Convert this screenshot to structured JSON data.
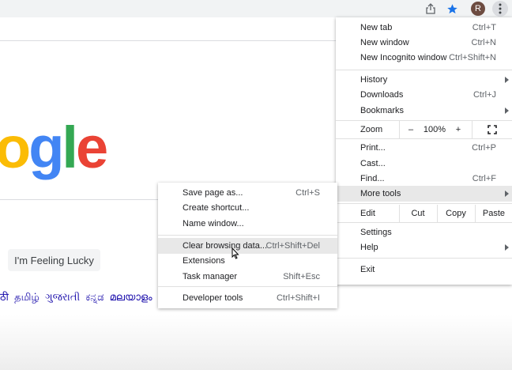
{
  "toolbar": {
    "avatar_initial": "R",
    "icons": {
      "share": "share-icon",
      "star": "star-icon",
      "menu": "kebab-menu-icon"
    },
    "colors": {
      "star": "#1a73e8",
      "avatar_bg": "#6d4c41"
    }
  },
  "page": {
    "logo_text": "ogle",
    "lucky_button": "I'm Feeling Lucky",
    "languages": [
      "ठी",
      "தமிழ்",
      "ગુજરાતી",
      "ಕನ್ನಡ",
      "മലയാളം"
    ]
  },
  "menu": {
    "new_tab": {
      "label": "New tab",
      "shortcut": "Ctrl+T"
    },
    "new_window": {
      "label": "New window",
      "shortcut": "Ctrl+N"
    },
    "new_incognito": {
      "label": "New Incognito window",
      "shortcut": "Ctrl+Shift+N"
    },
    "history": {
      "label": "History"
    },
    "downloads": {
      "label": "Downloads",
      "shortcut": "Ctrl+J"
    },
    "bookmarks": {
      "label": "Bookmarks"
    },
    "zoom": {
      "label": "Zoom",
      "minus": "–",
      "value": "100%",
      "plus": "+"
    },
    "print": {
      "label": "Print...",
      "shortcut": "Ctrl+P"
    },
    "cast": {
      "label": "Cast..."
    },
    "find": {
      "label": "Find...",
      "shortcut": "Ctrl+F"
    },
    "more_tools": {
      "label": "More tools"
    },
    "edit": {
      "label": "Edit",
      "cut": "Cut",
      "copy": "Copy",
      "paste": "Paste"
    },
    "settings": {
      "label": "Settings"
    },
    "help": {
      "label": "Help"
    },
    "exit": {
      "label": "Exit"
    }
  },
  "submenu": {
    "save_page": {
      "label": "Save page as...",
      "shortcut": "Ctrl+S"
    },
    "create_shortcut": {
      "label": "Create shortcut..."
    },
    "name_window": {
      "label": "Name window..."
    },
    "clear_data": {
      "label": "Clear browsing data...",
      "shortcut": "Ctrl+Shift+Del"
    },
    "extensions": {
      "label": "Extensions"
    },
    "task_manager": {
      "label": "Task manager",
      "shortcut": "Shift+Esc"
    },
    "developer_tools": {
      "label": "Developer tools",
      "shortcut": "Ctrl+Shift+I"
    }
  }
}
